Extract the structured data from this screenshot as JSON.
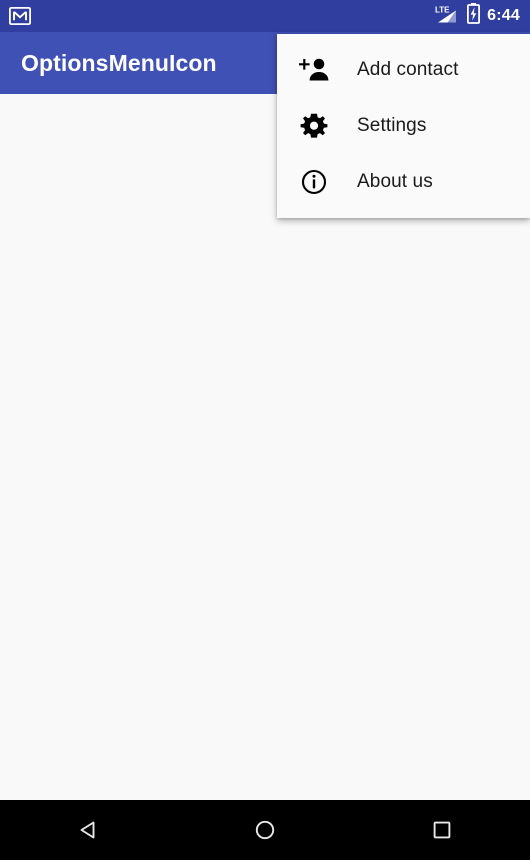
{
  "status_bar": {
    "notification_icon": "gmail-envelope-icon",
    "network_label": "LTE",
    "signal_icon": "signal-bars-icon",
    "battery_icon": "battery-charging-icon",
    "time": "6:44",
    "background_color": "#303F9F",
    "foreground_color": "#FFFFFF"
  },
  "app_bar": {
    "title": "OptionsMenuIcon",
    "background_color": "#3F51B5",
    "title_color": "#FFFFFF"
  },
  "content": {
    "background_color": "#F9F9F9"
  },
  "options_menu": {
    "background_color": "#FAFAFA",
    "items": [
      {
        "label": "Add contact",
        "icon": "person-add-icon"
      },
      {
        "label": "Settings",
        "icon": "gear-icon"
      },
      {
        "label": "About us",
        "icon": "info-circle-icon"
      }
    ]
  },
  "nav_bar": {
    "background_color": "#000000",
    "buttons": [
      {
        "name": "back",
        "icon": "back-triangle-icon"
      },
      {
        "name": "home",
        "icon": "home-circle-icon"
      },
      {
        "name": "recents",
        "icon": "recents-square-icon"
      }
    ]
  }
}
